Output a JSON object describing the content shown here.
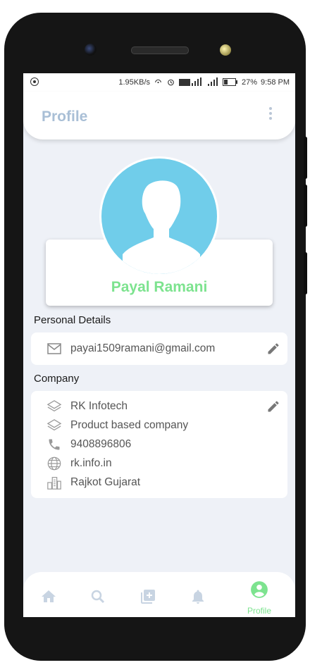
{
  "status": {
    "speed": "1.95KB/s",
    "battery": "27%",
    "time": "9:58 PM"
  },
  "header": {
    "title": "Profile"
  },
  "profile": {
    "name": "Payal Ramani"
  },
  "personal": {
    "label": "Personal Details",
    "email": "payai1509ramani@gmail.com"
  },
  "company": {
    "label": "Company",
    "name": "RK Infotech",
    "type": "Product based company",
    "phone": "9408896806",
    "website": "rk.info.in",
    "location": "Rajkot Gujarat"
  },
  "bottom_nav": {
    "active_label": "Profile",
    "items": [
      "home-icon",
      "search-icon",
      "add-library-icon",
      "bell-icon",
      "account-circle-icon"
    ]
  },
  "colors": {
    "accent": "#7de38f",
    "avatar_bg": "#70cdea",
    "title": "#a9bfd6",
    "background": "#eef1f7"
  }
}
